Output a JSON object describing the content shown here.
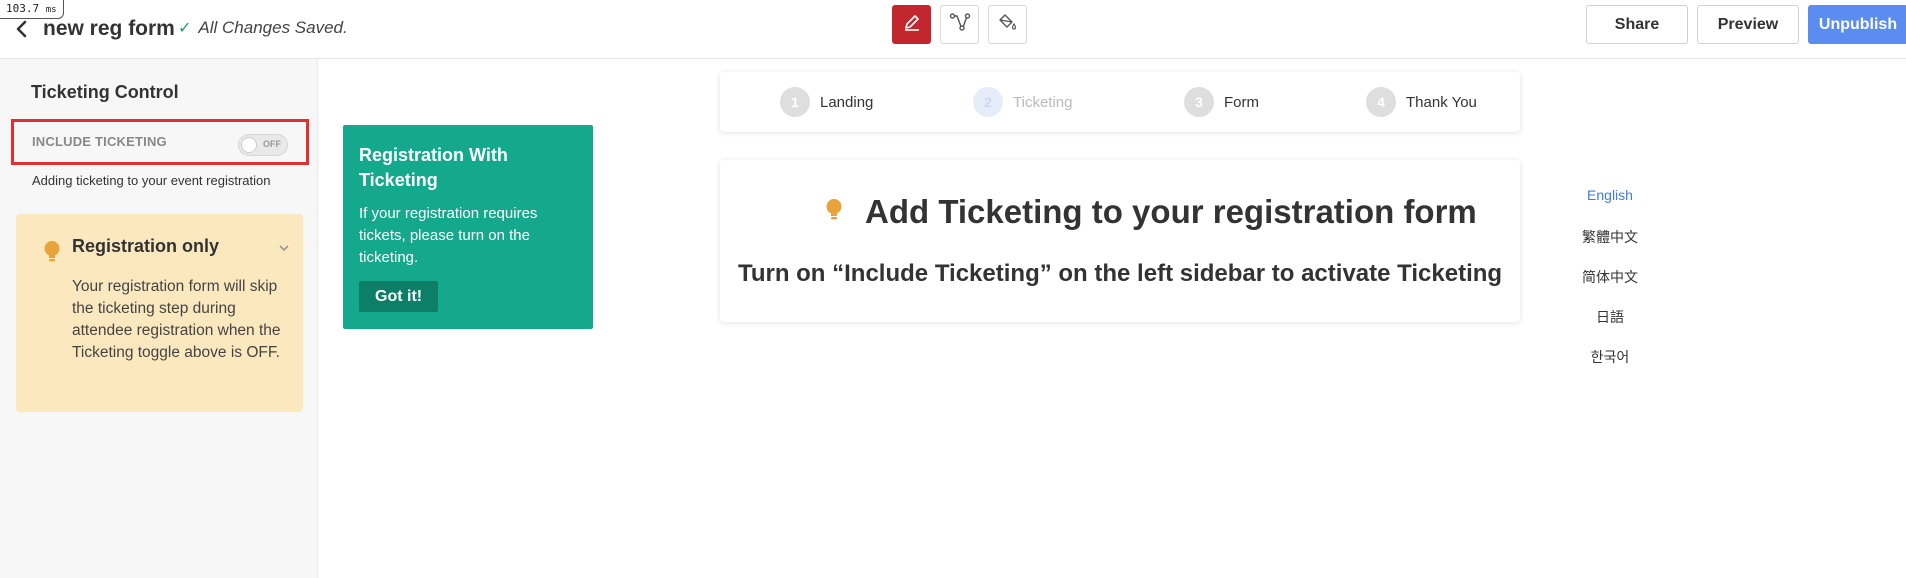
{
  "timing": {
    "value": "103.7",
    "unit": "ms"
  },
  "header": {
    "title": "new reg form",
    "save_status": "All Changes Saved.",
    "share_label": "Share",
    "preview_label": "Preview",
    "unpublish_label": "Unpublish"
  },
  "sidebar": {
    "title": "Ticketing Control",
    "include_label": "INCLUDE TICKETING",
    "toggle_state": "OFF",
    "include_desc": "Adding ticketing to your event registration",
    "card": {
      "title": "Registration only",
      "body": "Your registration form will skip the ticketing step during attendee registration when the Ticketing toggle above is OFF."
    }
  },
  "tip": {
    "title": "Registration With Ticketing",
    "body": "If your registration requires tickets, please turn on the ticketing.",
    "button_label": "Got it!"
  },
  "steps": [
    {
      "num": "1",
      "label": "Landing"
    },
    {
      "num": "2",
      "label": "Ticketing"
    },
    {
      "num": "3",
      "label": "Form"
    },
    {
      "num": "4",
      "label": "Thank You"
    }
  ],
  "main": {
    "heading": "Add Ticketing to your registration form",
    "subheading": "Turn on “Include Ticketing” on the left sidebar to activate Ticketing"
  },
  "languages": [
    "English",
    "繁體中文",
    "简体中文",
    "日語",
    "한국어"
  ],
  "colors": {
    "accent_red": "#c2272d",
    "accent_blue": "#5b8df0",
    "tip_green": "#14a88c",
    "card_yellow": "#fbe8bf",
    "bulb_orange": "#e8a33a"
  },
  "icons": [
    "back-chevron-icon",
    "check-icon",
    "pencil-icon",
    "flow-icon",
    "paint-bucket-icon",
    "lightbulb-icon",
    "chevron-down-icon"
  ]
}
